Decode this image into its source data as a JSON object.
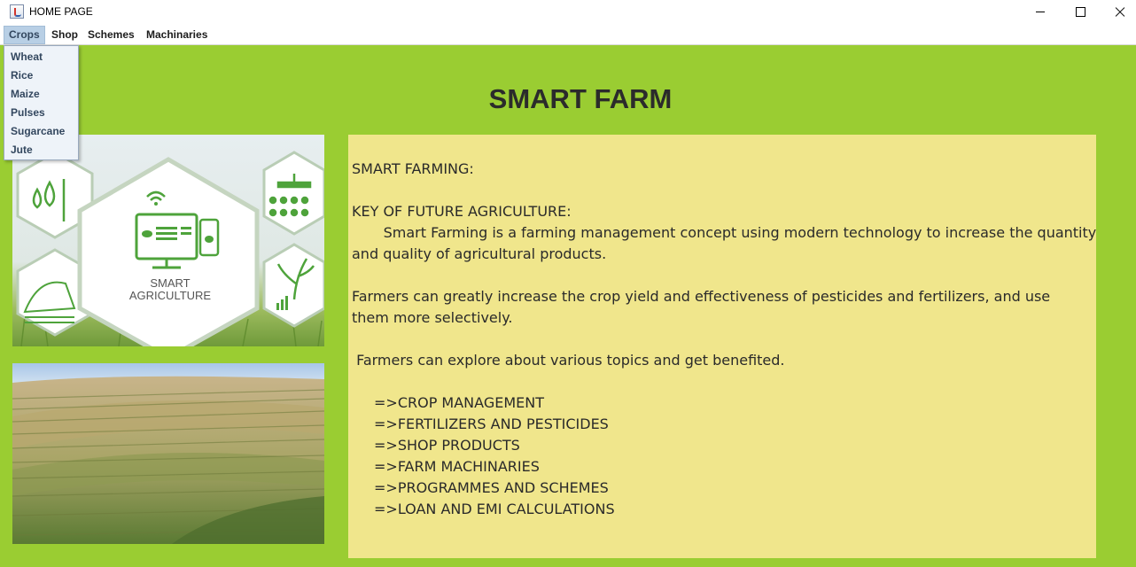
{
  "window": {
    "title": "HOME PAGE",
    "controls": [
      "minimize-icon",
      "maximize-icon",
      "close-icon"
    ]
  },
  "menubar": {
    "items": [
      {
        "label": "Crops",
        "active": true
      },
      {
        "label": "Shop"
      },
      {
        "label": "Schemes"
      },
      {
        "label": "Machinaries"
      }
    ]
  },
  "crops_menu": {
    "items": [
      "Wheat",
      "Rice",
      "Maize",
      "Pulses",
      "Sugarcane",
      "Jute"
    ]
  },
  "main": {
    "title": "SMART FARM",
    "images": [
      {
        "label": "SMART",
        "label2": "AGRICULTURE",
        "icon": "smart-agriculture-image"
      },
      {
        "icon": "crop-field-image"
      }
    ],
    "info": {
      "heading": "SMART FARMING:",
      "subheading": "KEY OF FUTURE AGRICULTURE:",
      "para1_line1": "       Smart Farming is a farming management concept using modern technology to increase the quantity",
      "para1_line2": "and quality of agricultural products.",
      "para2_line1": "Farmers can greatly increase the crop yield and effectiveness of pesticides and fertilizers, and use",
      "para2_line2": "them more selectively.",
      "para3": " Farmers can explore about various topics and get benefited.",
      "topics": [
        "=>CROP MANAGEMENT",
        "=>FERTILIZERS AND PESTICIDES",
        "=>SHOP PRODUCTS",
        "=>FARM MACHINARIES",
        "=>PROGRAMMES AND SCHEMES",
        "=>LOAN AND EMI CALCULATIONS"
      ]
    }
  },
  "colors": {
    "background": "#9acd32",
    "info_panel": "#f0e68c",
    "menu_highlight": "#b8cfe5",
    "dropdown_bg": "#eef3f9"
  }
}
